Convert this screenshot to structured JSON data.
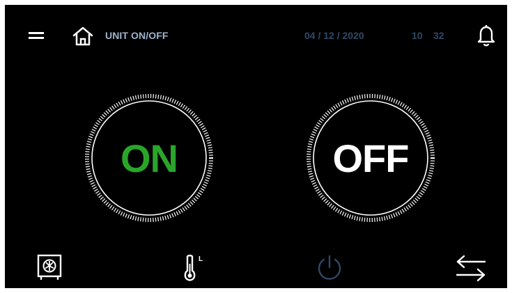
{
  "header": {
    "title": "UNIT ON/OFF",
    "date": "04 / 12 / 2020",
    "time_hours": "10",
    "time_minutes": "32"
  },
  "dials": {
    "on_label": "ON",
    "off_label": "OFF"
  },
  "bottom_bar": {
    "temperature_icon_letter": "L"
  },
  "colors": {
    "background": "#000000",
    "on_green": "#2aa52a",
    "off_white": "#ffffff",
    "header_text": "#9fb4cc",
    "datetime_text": "#2f4a66",
    "power_dim": "#2f4a66"
  },
  "icons": {
    "menu": "menu-icon",
    "home": "home-icon",
    "bell": "bell-icon",
    "unit": "unit-fan-icon",
    "temperature": "thermometer-icon",
    "power": "power-icon",
    "swap": "swap-arrows-icon"
  }
}
